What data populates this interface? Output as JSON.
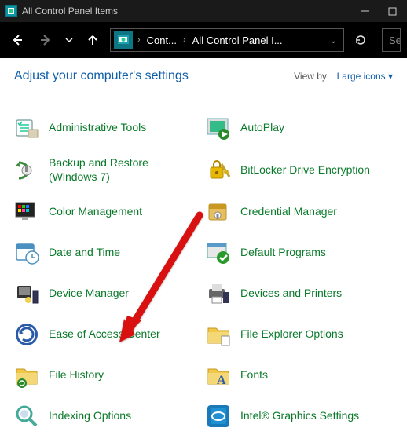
{
  "window": {
    "title": "All Control Panel Items"
  },
  "breadcrumb": {
    "part1": "Cont...",
    "part2": "All Control Panel I..."
  },
  "search": {
    "placeholder": "Search Control Pa"
  },
  "header": {
    "adjust": "Adjust your computer's settings",
    "view_by_label": "View by:",
    "view_by_value": "Large icons"
  },
  "items": {
    "left": [
      {
        "label": "Administrative Tools"
      },
      {
        "label": "Backup and Restore (Windows 7)"
      },
      {
        "label": "Color Management"
      },
      {
        "label": "Date and Time"
      },
      {
        "label": "Device Manager"
      },
      {
        "label": "Ease of Access Center"
      },
      {
        "label": "File History"
      },
      {
        "label": "Indexing Options"
      }
    ],
    "right": [
      {
        "label": "AutoPlay"
      },
      {
        "label": "BitLocker Drive Encryption"
      },
      {
        "label": "Credential Manager"
      },
      {
        "label": "Default Programs"
      },
      {
        "label": "Devices and Printers"
      },
      {
        "label": "File Explorer Options"
      },
      {
        "label": "Fonts"
      },
      {
        "label": "Intel® Graphics Settings"
      }
    ]
  }
}
